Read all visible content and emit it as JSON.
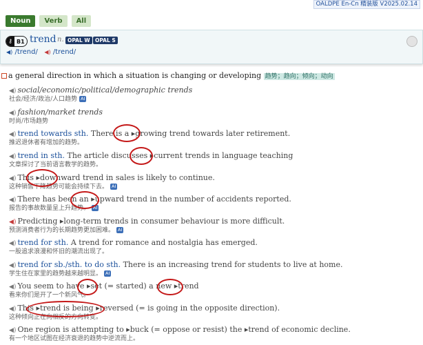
{
  "version_label": "OALDPE En-Cn 精装版 V2025.02.14",
  "tabs": [
    "Noun",
    "Verb",
    "All"
  ],
  "entry": {
    "cefr": "B1",
    "headword": "trend",
    "pos": "n.",
    "opal_w": "OPAL W",
    "opal_s": "OPAL S",
    "pron_uk": "/trend/",
    "pron_us": "/trend/"
  },
  "sense": {
    "definition": "a general direction in which a situation is changing or developing",
    "chinese": "趋势；趋向；倾向；动向"
  },
  "examples": [
    {
      "en_cf": "",
      "en": "social/economic/political/demographic trends",
      "zh": "社会/经济/政治/人口趋势",
      "ai": "AI"
    },
    {
      "en_cf": "",
      "en": "fashion/market trends",
      "zh": "时尚/市场趋势",
      "ai": ""
    },
    {
      "en_cf": "trend towards sth.",
      "en": " There is a ▸growing trend towards later retirement.",
      "zh": "推迟退休者有增加的趋势。",
      "ai": ""
    },
    {
      "en_cf": "trend in sth.",
      "en": " The article discusses ▸current trends in language teaching",
      "zh": "文章探讨了当前语言教学的趋势。",
      "ai": ""
    },
    {
      "en_cf": "",
      "en": "This ▸downward trend in sales is likely to continue.",
      "zh": "这种销售下降趋势可能会持续下去。",
      "ai": "AI"
    },
    {
      "en_cf": "",
      "en": "There has been an ▸upward trend in the number of accidents reported.",
      "zh": "报告的事故数量呈上升趋势。",
      "ai": "AI"
    },
    {
      "en_cf": "",
      "en": "Predicting ▸long-term trends in consumer behaviour is more difficult.",
      "zh": "预测消费者行为的长期趋势更加困难。",
      "ai": "AI"
    },
    {
      "en_cf": "trend for sth.",
      "en": " A trend for romance and nostalgia has emerged.",
      "zh": "一股追求浪漫和怀旧的潮流出现了。",
      "ai": ""
    },
    {
      "en_cf": "trend for sb./sth. to do sth.",
      "en": " There is an increasing trend for students to live at home.",
      "zh": "学生住在家里的趋势越来越明显。",
      "ai": "AI"
    },
    {
      "en_cf": "",
      "en": "You seem to have ▸set (= started) a new ▸trend",
      "zh": "看来你们是开了一个新风气。",
      "ai": ""
    },
    {
      "en_cf": "",
      "en": "This ▸trend is being ▸reversed (= is going in the opposite direction).",
      "zh": "这种倾向正在向相反的方向转变。",
      "ai": ""
    },
    {
      "en_cf": "",
      "en": "One region is attempting to ▸buck (= oppose or resist) the ▸trend of economic decline.",
      "zh": "有一个地区试图在经济衰退的趋势中逆流而上。",
      "ai": ""
    }
  ],
  "colors": {
    "accent": "#1a4f9a",
    "tab_active": "#3a7a2e",
    "highlight_ring": "#c41818"
  },
  "icons": {
    "speaker": "speaker-icon",
    "settings": "settings-icon"
  }
}
